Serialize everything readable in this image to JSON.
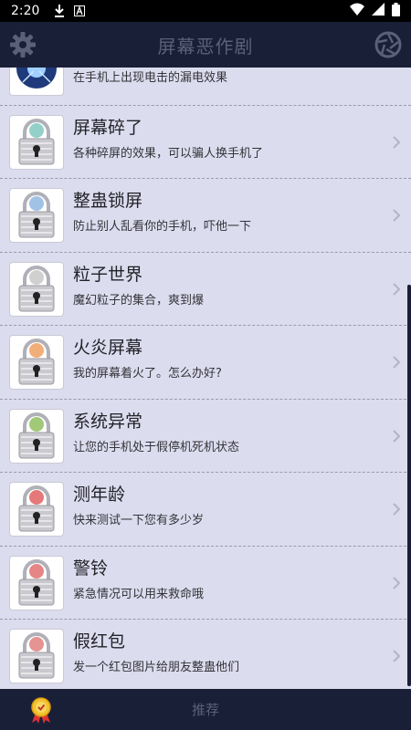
{
  "status_bar": {
    "time": "2:20",
    "icons": [
      "download-icon",
      "a-box-icon",
      "wifi-icon",
      "signal-icon",
      "battery-icon"
    ]
  },
  "app_bar": {
    "title": "屏幕恶作剧",
    "left_icon": "gear-icon",
    "right_icon": "aperture-icon"
  },
  "list": {
    "items": [
      {
        "title": "",
        "desc": "在手机上出现电击的漏电效果",
        "icon": "electric-shock-icon",
        "accent": "#3a7bd5"
      },
      {
        "title": "屏幕碎了",
        "desc": "各种碎屏的效果，可以骗人换手机了",
        "icon": "lock-icon",
        "accent": "#7fc8c0"
      },
      {
        "title": "整蛊锁屏",
        "desc": "防止别人乱看你的手机，吓他一下",
        "icon": "lock-icon",
        "accent": "#8fb8e0"
      },
      {
        "title": "粒子世界",
        "desc": "魔幻粒子的集合，爽到爆",
        "icon": "lock-icon",
        "accent": "#c8c8c8"
      },
      {
        "title": "火炎屏幕",
        "desc": "我的屏幕着火了。怎么办好?",
        "icon": "lock-icon",
        "accent": "#f0a060"
      },
      {
        "title": "系统异常",
        "desc": "让您的手机处于假停机死机状态",
        "icon": "lock-icon",
        "accent": "#90c060"
      },
      {
        "title": "测年龄",
        "desc": "快来测试一下您有多少岁",
        "icon": "lock-icon",
        "accent": "#e06060"
      },
      {
        "title": "警铃",
        "desc": "紧急情况可以用来救命哦",
        "icon": "lock-icon",
        "accent": "#e07070"
      },
      {
        "title": "假红包",
        "desc": "发一个红包图片给朋友整蛊他们",
        "icon": "lock-icon",
        "accent": "#e08080"
      }
    ]
  },
  "bottom_bar": {
    "tab_label": "推荐",
    "left_icon": "award-badge-icon"
  }
}
